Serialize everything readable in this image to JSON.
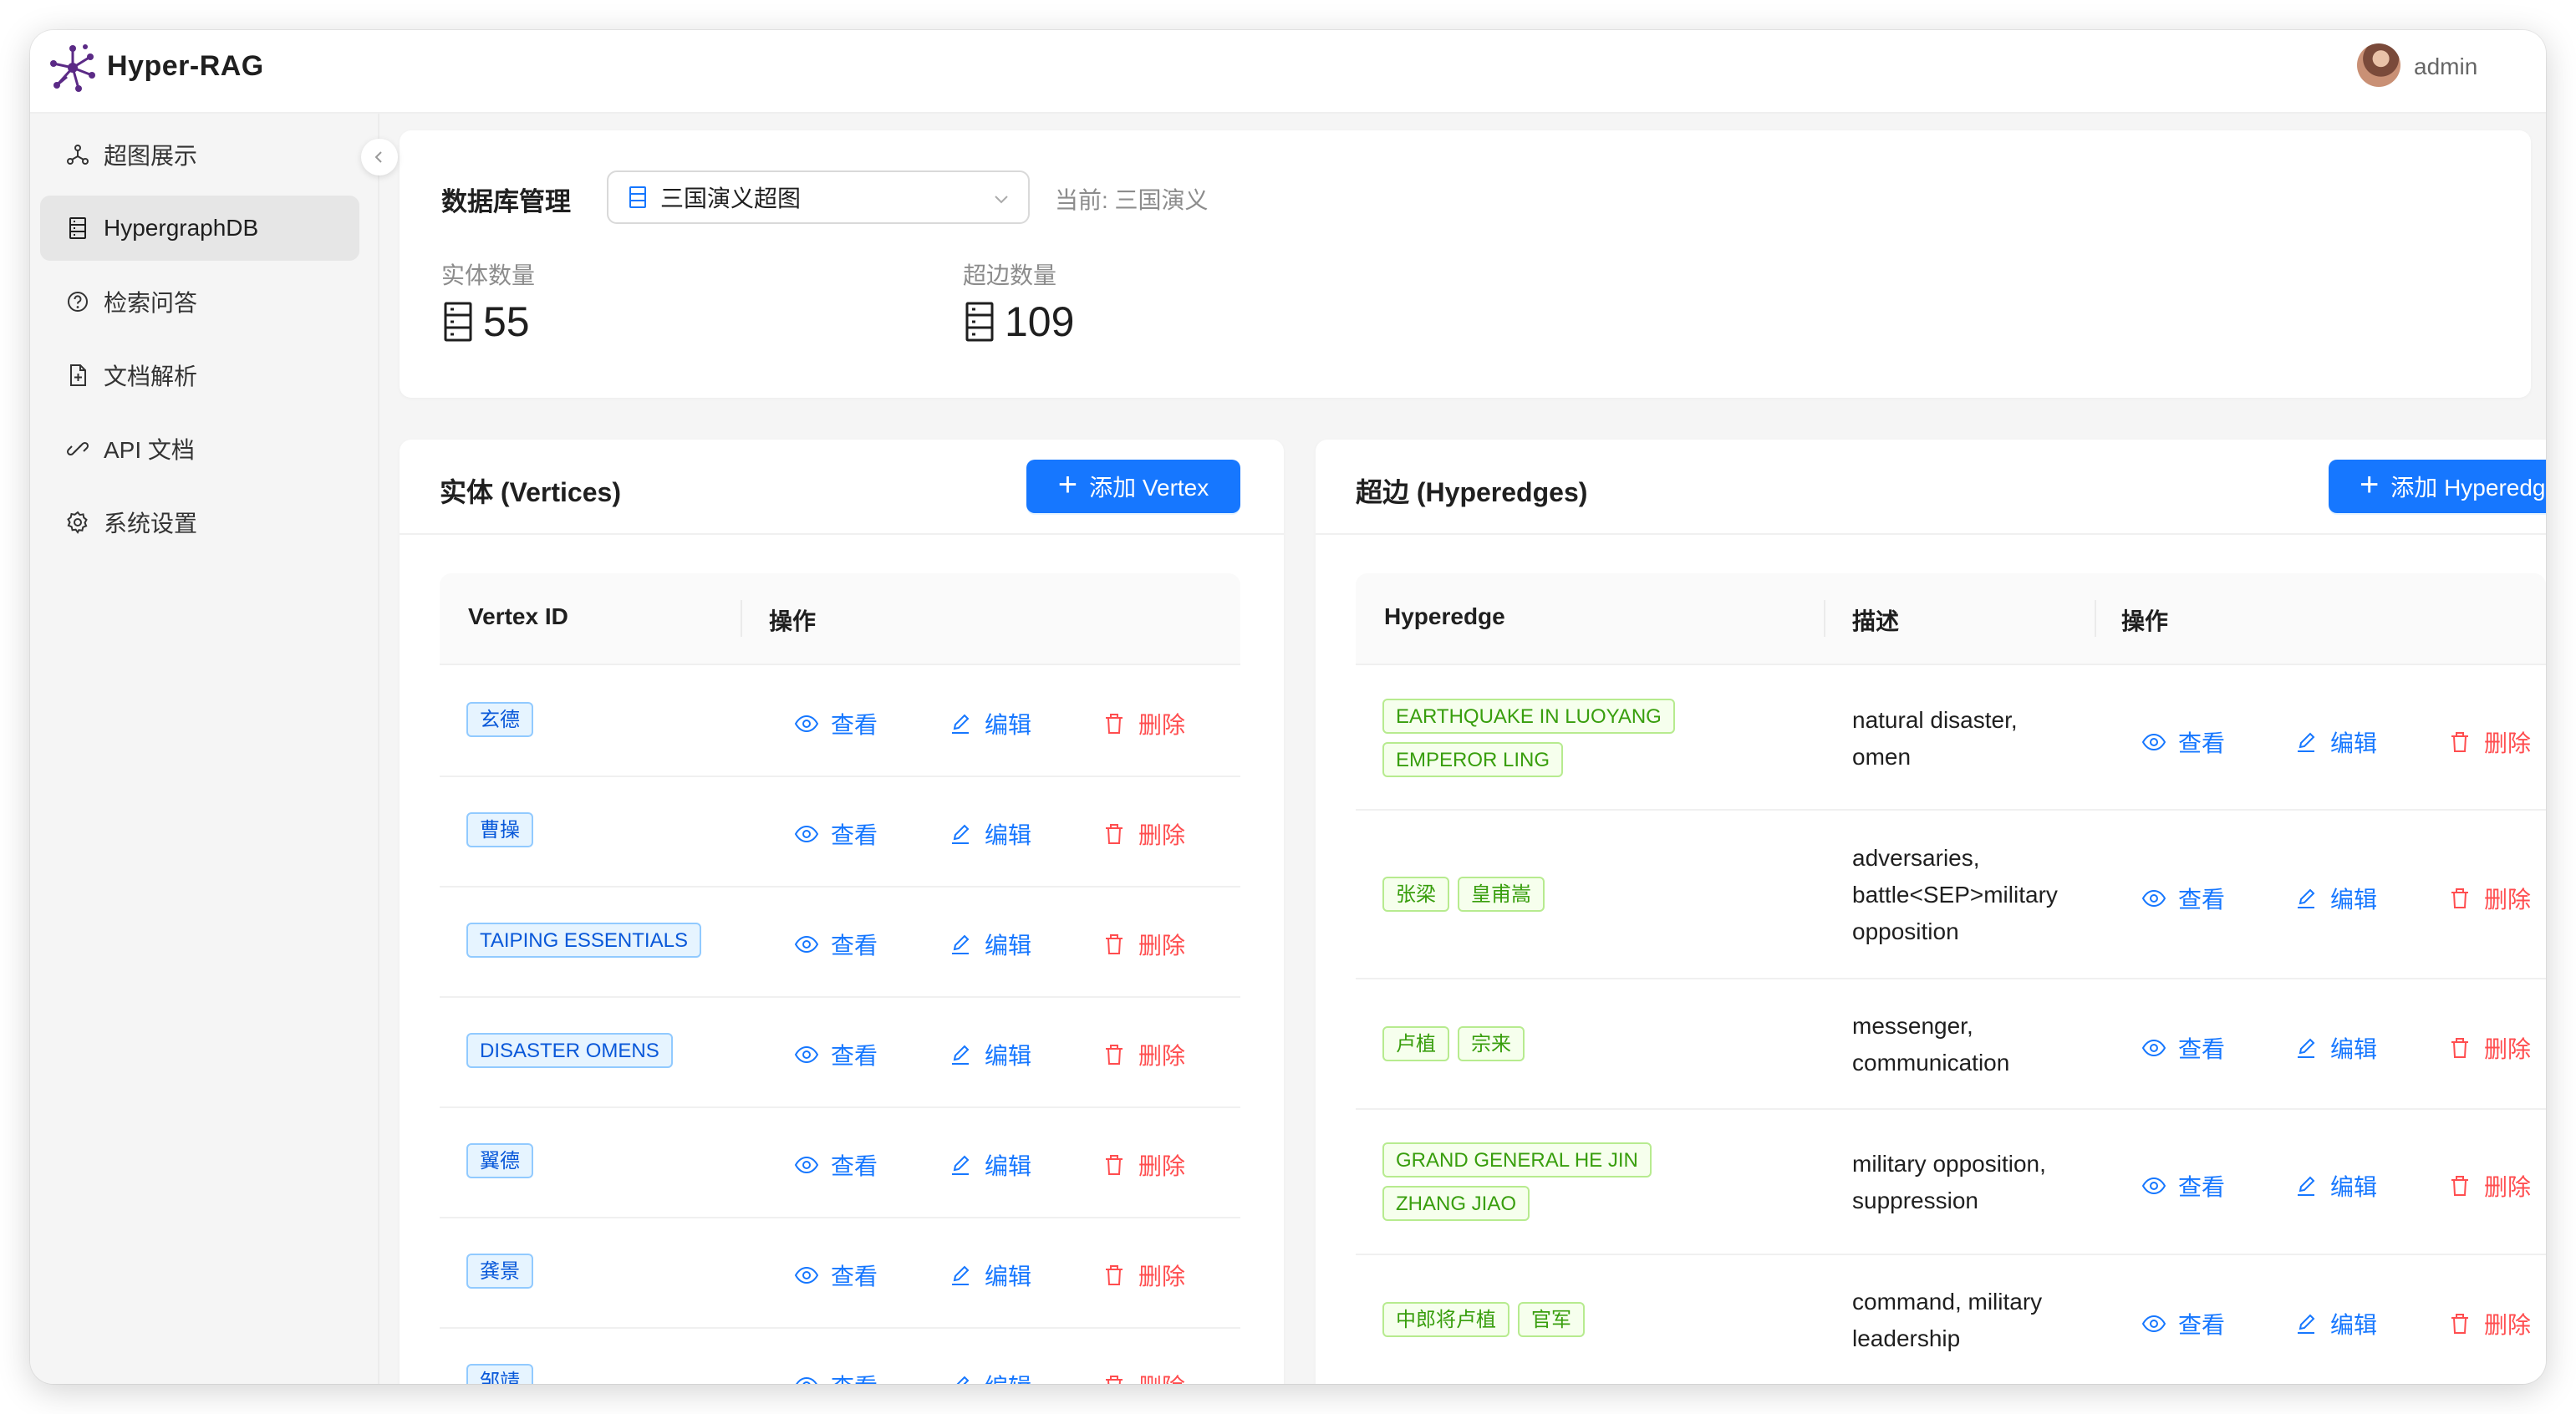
{
  "app": {
    "title": "Hyper-RAG",
    "username": "admin"
  },
  "sidebar": {
    "items": [
      {
        "label": "超图展示",
        "icon": "graph-icon"
      },
      {
        "label": "HypergraphDB",
        "icon": "database-icon"
      },
      {
        "label": "检索问答",
        "icon": "question-icon"
      },
      {
        "label": "文档解析",
        "icon": "file-add-icon"
      },
      {
        "label": "API 文档",
        "icon": "link-icon"
      },
      {
        "label": "系统设置",
        "icon": "gear-icon"
      }
    ],
    "active_index": 1
  },
  "db": {
    "label": "数据库管理",
    "selected": "三国演义超图",
    "current": "当前: 三国演义",
    "entity_label": "实体数量",
    "entity_count": "55",
    "edge_label": "超边数量",
    "edge_count": "109"
  },
  "vertices": {
    "title": "实体 (Vertices)",
    "add_label": "添加 Vertex",
    "headers": [
      "Vertex ID",
      "操作"
    ],
    "rows": [
      "玄德",
      "曹操",
      "TAIPING ESSENTIALS",
      "DISASTER OMENS",
      "翼德",
      "龚景",
      "邹靖"
    ]
  },
  "hyperedges": {
    "title": "超边 (Hyperedges)",
    "add_label": "添加 Hyperedge",
    "headers": [
      "Hyperedge",
      "描述",
      "操作"
    ],
    "rows": [
      {
        "tags": [
          "EARTHQUAKE IN LUOYANG",
          "EMPEROR LING"
        ],
        "desc": [
          "natural disaster,",
          "omen"
        ]
      },
      {
        "tags": [
          "张梁",
          "皇甫嵩"
        ],
        "desc": [
          "adversaries,",
          "battle<SEP>military",
          "opposition"
        ]
      },
      {
        "tags": [
          "卢植",
          "宗来"
        ],
        "desc": [
          "messenger,",
          "communication"
        ]
      },
      {
        "tags": [
          "GRAND GENERAL HE JIN",
          "ZHANG JIAO"
        ],
        "desc": [
          "military opposition,",
          "suppression"
        ]
      },
      {
        "tags": [
          "中郎将卢植",
          "官军"
        ],
        "desc": [
          "command, military",
          "leadership"
        ]
      }
    ]
  },
  "actions": {
    "view": "查看",
    "edit": "编辑",
    "delete": "删除"
  },
  "colors": {
    "primary": "#1677ff",
    "danger": "#ff4d4f",
    "tag_blue": "#0958d9",
    "tag_green": "#389e0d"
  }
}
